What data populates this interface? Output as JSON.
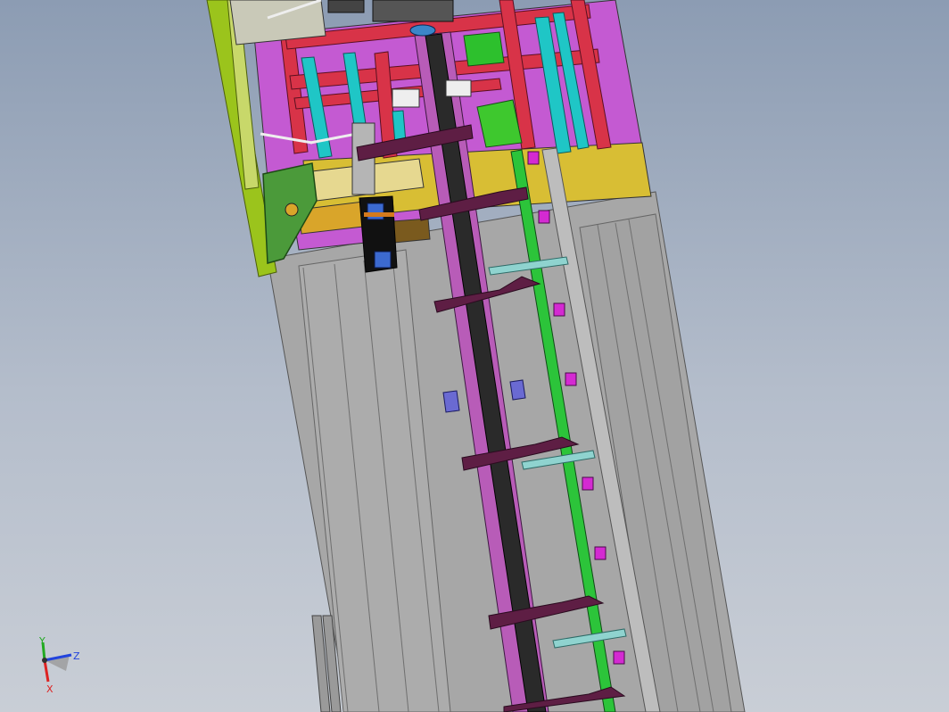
{
  "viewport": {
    "background_top": "#8c9cb3",
    "background_bottom": "#c9ced6"
  },
  "colors": {
    "frame_gray": "#a9a9a9",
    "frame_gray_dark": "#8f8f8f",
    "magenta_panel": "#c05ad0",
    "red_frame": "#d8334a",
    "cyan_bar": "#1fc3c3",
    "olive_green": "#9cc51d",
    "green_plate": "#4a9a3a",
    "yellow_plate": "#d9c23a",
    "lime_rail": "#29c23a",
    "violet_rail": "#b55ab5",
    "black_belt": "#2a2a2a",
    "dark_purple_paddle": "#5e1e44",
    "pink_clip": "#d22ad2",
    "teal_bracket": "#8fd5d0",
    "blue_tab": "#6a6ad0"
  },
  "triad": {
    "y_label": "Y",
    "z_label": "Z",
    "x_label": "X",
    "y_color": "#22aa22",
    "z_color": "#2244dd",
    "x_color": "#dd2222"
  }
}
